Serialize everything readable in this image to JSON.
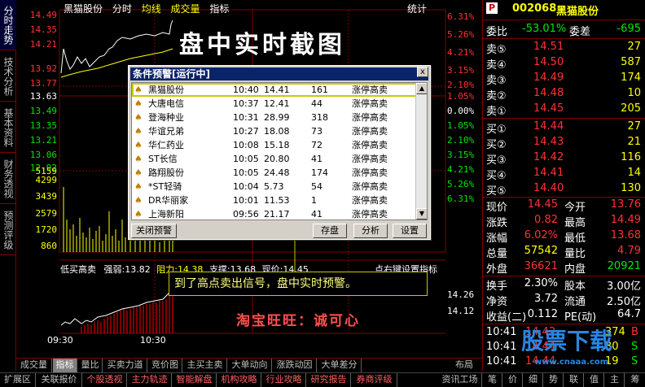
{
  "left_tabs": [
    "分时走势",
    "技术分析",
    "基本资料",
    "财务透视",
    "预测评级"
  ],
  "chart_header": {
    "stock": "黑猫股份",
    "items": [
      "分时",
      "均线",
      "成交量",
      "指标"
    ],
    "right_label": "统计"
  },
  "price_axis_left": [
    "14.49",
    "14.35",
    "14.21",
    "13.92",
    "13.77",
    "13.63",
    "13.49",
    "13.35",
    "13.21",
    "13.06",
    "12.92"
  ],
  "volume_axis_left": [
    "5159",
    "4299",
    "3439",
    "2579",
    "1720",
    "860"
  ],
  "pct_axis_right": [
    "6.31%",
    "5.26%",
    "4.21%",
    "3.15%",
    "2.10%",
    "1.05%",
    "0.00%",
    "1.05%",
    "2.10%",
    "3.15%",
    "4.21%",
    "5.26%",
    "6.31%"
  ],
  "lower_indicator": {
    "name": "低买高卖",
    "strong_label": "强弱:",
    "strong_val": "13.82",
    "resist_label": "阻力:",
    "resist_val": "14.38",
    "support_label": "支撑:",
    "support_val": "13.68",
    "price_label": "现价:",
    "price_val": "14.45",
    "right_hint": "点右键设置指标",
    "axis": [
      "14.26",
      "14.12"
    ]
  },
  "time_axis": [
    "09:30",
    "10:30"
  ],
  "dialog": {
    "title": "条件预警[运行中]",
    "close": "x",
    "rows": [
      {
        "name": "黑猫股份",
        "time": "10:40",
        "price": "14.41",
        "qty": "161",
        "cond": "涨停高卖"
      },
      {
        "name": "大唐电信",
        "time": "10:37",
        "price": "12.41",
        "qty": "44",
        "cond": "涨停高卖"
      },
      {
        "name": "登海种业",
        "time": "10:31",
        "price": "28.99",
        "qty": "318",
        "cond": "涨停高卖"
      },
      {
        "name": "华谊兄弟",
        "time": "10:27",
        "price": "18.08",
        "qty": "73",
        "cond": "涨停高卖"
      },
      {
        "name": "华仁药业",
        "time": "10:08",
        "price": "15.18",
        "qty": "72",
        "cond": "涨停高卖"
      },
      {
        "name": "ST长信",
        "time": "10:05",
        "price": "20.80",
        "qty": "41",
        "cond": "涨停高卖"
      },
      {
        "name": "路翔股份",
        "time": "10:05",
        "price": "24.48",
        "qty": "174",
        "cond": "涨停高卖"
      },
      {
        "name": "*ST轻骑",
        "time": "10:04",
        "price": "5.73",
        "qty": "54",
        "cond": "涨停高卖"
      },
      {
        "name": "DR华丽家",
        "time": "10:01",
        "price": "11.53",
        "qty": "1",
        "cond": "涨停高卖"
      },
      {
        "name": "上海新阳",
        "time": "09:56",
        "price": "21.17",
        "qty": "41",
        "cond": "涨停高卖"
      }
    ],
    "btn_close": "关闭预警",
    "btn_save": "存盘",
    "btn_analyze": "分析",
    "btn_settings": "设置"
  },
  "overlay": {
    "calligraphy": "盘中实时截图",
    "callout": "到了高点卖出信号，盘中实时预警。",
    "taobao": "淘宝旺旺：诚可心",
    "watermark": "股票下载",
    "watermark_url": "www.cnaaa.com"
  },
  "quote": {
    "marker": "P",
    "code": "002068",
    "name": "黑猫股份",
    "wb_label": "委比",
    "wb_val": "-53.01%",
    "wc_label": "委差",
    "wc_val": "-695",
    "asks": [
      {
        "label": "卖⑤",
        "price": "14.51",
        "vol": "27"
      },
      {
        "label": "卖④",
        "price": "14.50",
        "vol": "587"
      },
      {
        "label": "卖③",
        "price": "14.49",
        "vol": "174"
      },
      {
        "label": "卖②",
        "price": "14.48",
        "vol": "10"
      },
      {
        "label": "卖①",
        "price": "14.45",
        "vol": "205"
      }
    ],
    "bids": [
      {
        "label": "买①",
        "price": "14.44",
        "vol": "27"
      },
      {
        "label": "买②",
        "price": "14.43",
        "vol": "21"
      },
      {
        "label": "买③",
        "price": "14.42",
        "vol": "116"
      },
      {
        "label": "买④",
        "price": "14.41",
        "vol": "14"
      },
      {
        "label": "买⑤",
        "price": "14.40",
        "vol": "130"
      }
    ],
    "stats": [
      {
        "l1": "现价",
        "v1": "14.45",
        "c1": "red",
        "l2": "今开",
        "v2": "13.76",
        "c2": "red"
      },
      {
        "l1": "涨跌",
        "v1": "0.82",
        "c1": "red",
        "l2": "最高",
        "v2": "14.49",
        "c2": "red"
      },
      {
        "l1": "涨幅",
        "v1": "6.02%",
        "c1": "red",
        "l2": "最低",
        "v2": "13.68",
        "c2": "red"
      },
      {
        "l1": "总量",
        "v1": "57542",
        "c1": "yellow",
        "l2": "量比",
        "v2": "4.79",
        "c2": "red"
      },
      {
        "l1": "外盘",
        "v1": "36621",
        "c1": "red",
        "l2": "内盘",
        "v2": "20921",
        "c2": "green"
      }
    ],
    "stats2": [
      {
        "l1": "换手",
        "v1": "2.30%",
        "l2": "股本",
        "v2": "3.00亿"
      },
      {
        "l1": "净资",
        "v1": "3.72",
        "l2": "流通",
        "v2": "2.50亿"
      },
      {
        "l1": "收益(二)",
        "v1": "0.112",
        "l2": "PE(动)",
        "v2": "64.7"
      }
    ],
    "ticks": [
      {
        "time": "10:41",
        "price": "14.42",
        "vol": "374",
        "flag": "B"
      },
      {
        "time": "10:41",
        "price": "14.44",
        "vol": "30",
        "flag": "S"
      },
      {
        "time": "10:41",
        "price": "14.44",
        "vol": "19",
        "flag": "S"
      }
    ]
  },
  "bottom_tabs1": [
    "成交量",
    "指标",
    "量比",
    "买卖力道",
    "竞价图",
    "主买主卖",
    "大单动向",
    "涨跌动因",
    "大单差分",
    "布局"
  ],
  "bottom_tabs2": [
    "扩展区",
    "关联报价",
    "个股透视",
    "主力轨迹",
    "智能解盘",
    "机构攻略",
    "行业攻略",
    "研究报告",
    "券商评级",
    "资讯工场",
    "笔",
    "价",
    "细",
    "势",
    "联",
    "值",
    "主",
    "筹"
  ]
}
